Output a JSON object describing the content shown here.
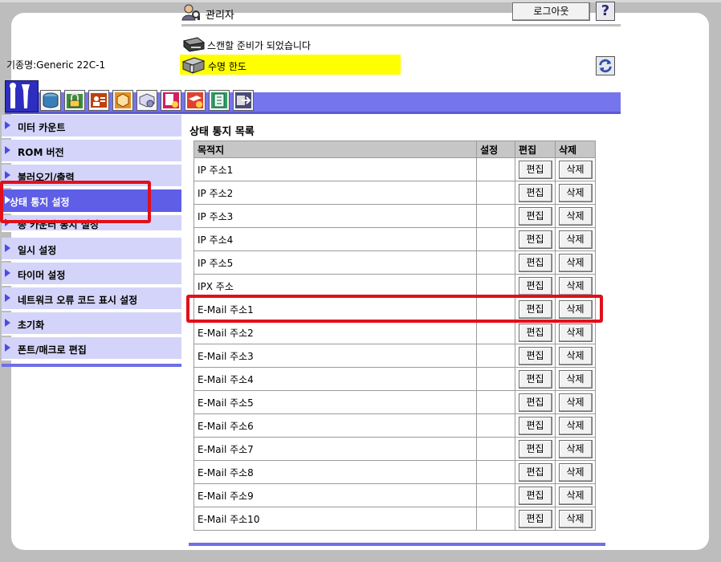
{
  "header": {
    "admin_label": "관리자",
    "logout_label": "로그아웃",
    "help_label": "?",
    "scan_status": "스캔할 준비가 되었습니다",
    "warning_text": "수명 한도",
    "model_label": "기종명:Generic 22C-1"
  },
  "sidebar": {
    "items": [
      {
        "label": "미터 카운트"
      },
      {
        "label": "ROM 버전"
      },
      {
        "label": "불러오기/출력"
      },
      {
        "label": "상태 통지 설정"
      },
      {
        "label": "총 카운터 통지 설정"
      },
      {
        "label": "일시 설정"
      },
      {
        "label": "타이머 설정"
      },
      {
        "label": "네트워크 오류 코드 표시 설정"
      },
      {
        "label": "초기화"
      },
      {
        "label": "폰트/매크로 편집"
      }
    ],
    "active_index": 3
  },
  "main": {
    "title": "상태 통지 목록",
    "columns": [
      "목적지",
      "설정",
      "편집",
      "삭제"
    ],
    "edit_label": "편집",
    "delete_label": "삭제",
    "rows": [
      "IP 주소1",
      "IP 주소2",
      "IP 주소3",
      "IP 주소4",
      "IP 주소5",
      "IPX 주소",
      "E-Mail 주소1",
      "E-Mail 주소2",
      "E-Mail 주소3",
      "E-Mail 주소4",
      "E-Mail 주소5",
      "E-Mail 주소6",
      "E-Mail 주소7",
      "E-Mail 주소8",
      "E-Mail 주소9",
      "E-Mail 주소10"
    ]
  },
  "colors": {
    "accent": "#7575ee",
    "sidebar_bg": "#d4d4fa",
    "active_bg": "#5e5ee6",
    "warning_bg": "#ffff00",
    "highlight": "#e0101c"
  }
}
